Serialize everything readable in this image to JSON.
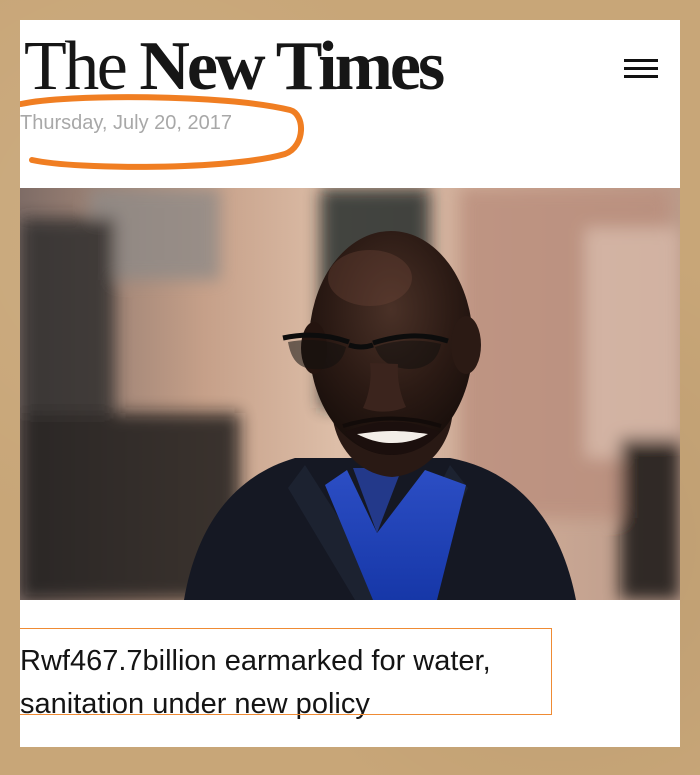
{
  "masthead": {
    "the": "The",
    "rest": "New Times"
  },
  "header": {
    "date": "Thursday, July 20, 2017"
  },
  "article": {
    "headline": "Rwf467.7billion earmarked for water, sanitation under new policy"
  },
  "image": {
    "subject": "man in glasses speaking"
  },
  "icons": {
    "menu": "hamburger-menu-icon"
  },
  "colors": {
    "annotation": "#f07e22",
    "masthead": "#161616",
    "date": "#a8a8a8"
  }
}
